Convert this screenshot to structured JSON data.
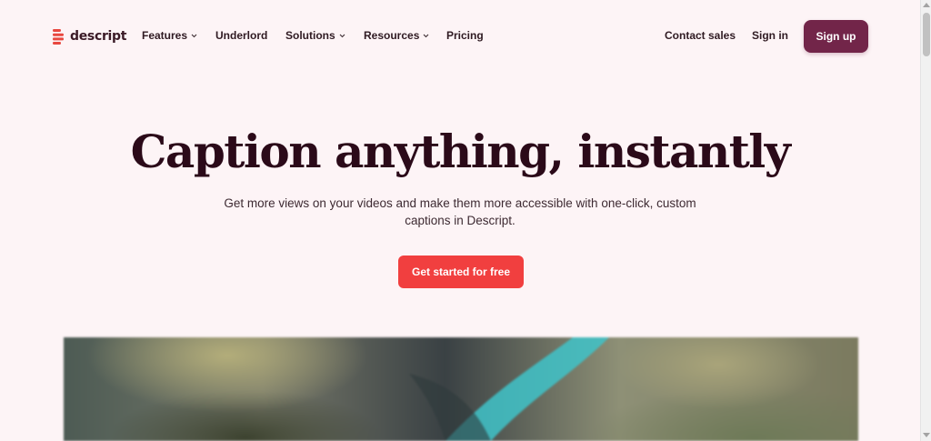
{
  "brand": {
    "name": "descript",
    "color": "#e8473f"
  },
  "nav": {
    "items": [
      {
        "label": "Features",
        "has_dropdown": true
      },
      {
        "label": "Underlord",
        "has_dropdown": false
      },
      {
        "label": "Solutions",
        "has_dropdown": true
      },
      {
        "label": "Resources",
        "has_dropdown": true
      },
      {
        "label": "Pricing",
        "has_dropdown": false
      }
    ],
    "contact_sales": "Contact sales",
    "sign_in": "Sign in",
    "sign_up": "Sign up"
  },
  "hero": {
    "title": "Caption anything, instantly",
    "subtitle": "Get more views on your videos and make them more accessible with one-click, custom captions in Descript.",
    "cta": "Get started for free"
  },
  "colors": {
    "background": "#fdf4f6",
    "signup_button": "#722549",
    "cta_button": "#f13f3f",
    "title_text": "#2b0a19"
  },
  "media": {
    "icon": "aerial-river-image"
  }
}
